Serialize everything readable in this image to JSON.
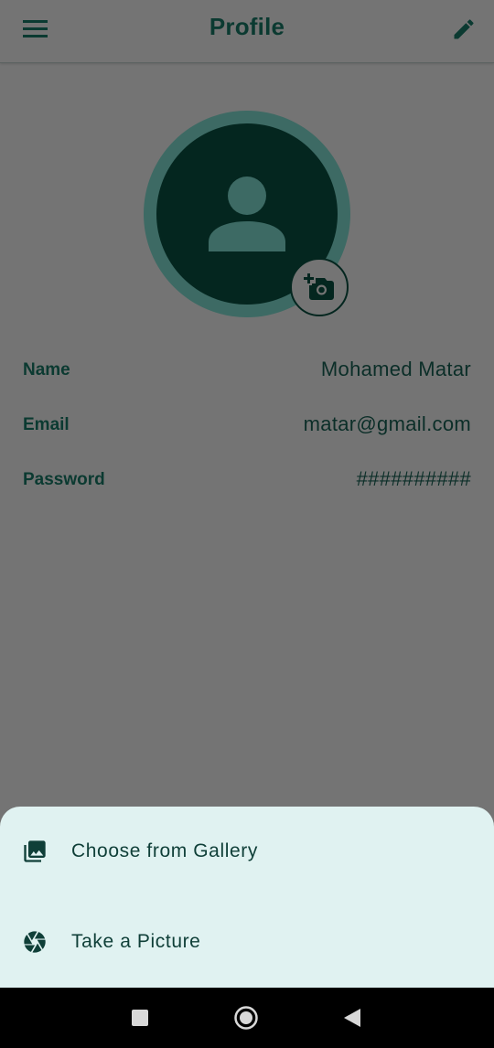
{
  "app_bar": {
    "title": "Profile",
    "menu_icon": "menu-icon",
    "edit_icon": "edit-pencil-icon"
  },
  "avatar": {
    "placeholder_icon": "person-icon",
    "change_photo_icon": "add-a-photo-icon"
  },
  "profile": {
    "fields": [
      {
        "label": "Name",
        "value": "Mohamed Matar"
      },
      {
        "label": "Email",
        "value": "matar@gmail.com"
      },
      {
        "label": "Password",
        "value": "##########"
      }
    ]
  },
  "bottom_sheet": {
    "items": [
      {
        "label": "Choose from Gallery",
        "icon": "photo-library-icon"
      },
      {
        "label": "Take a Picture",
        "icon": "camera-shutter-icon"
      }
    ]
  },
  "system_nav": {
    "buttons": [
      "recent-apps-icon",
      "home-icon",
      "back-icon"
    ]
  },
  "colors": {
    "primary_dark": "#0b3a31",
    "scrim_background": "#747474",
    "sheet_background": "#e0f2f1",
    "avatar_ring": "#3d6a64",
    "avatar_fill": "#04261f"
  }
}
